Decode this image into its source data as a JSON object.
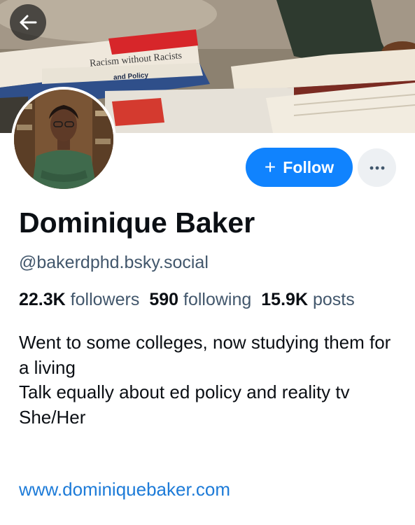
{
  "header": {
    "back_icon": "arrow-left-icon",
    "banner_book_text_1": "Racism without Racists",
    "banner_book_text_2": "and Policy"
  },
  "profile": {
    "name": "Dominique Baker",
    "handle": "@bakerdphd.bsky.social",
    "follow_label": "Follow",
    "follow_icon": "plus-icon",
    "more_icon": "ellipsis-icon",
    "stats": {
      "followers_count": "22.3K",
      "followers_label": "followers",
      "following_count": "590",
      "following_label": "following",
      "posts_count": "15.9K",
      "posts_label": "posts"
    },
    "bio_lines": [
      "Went to some colleges, now studying them for a living",
      "Talk equally about ed policy and reality tv",
      "She/Her"
    ],
    "website": "www.dominiquebaker.com"
  },
  "colors": {
    "accent": "#1083fe",
    "link": "#1d7bd8",
    "muted_text": "#42576c",
    "more_button_bg": "#edf0f3"
  }
}
